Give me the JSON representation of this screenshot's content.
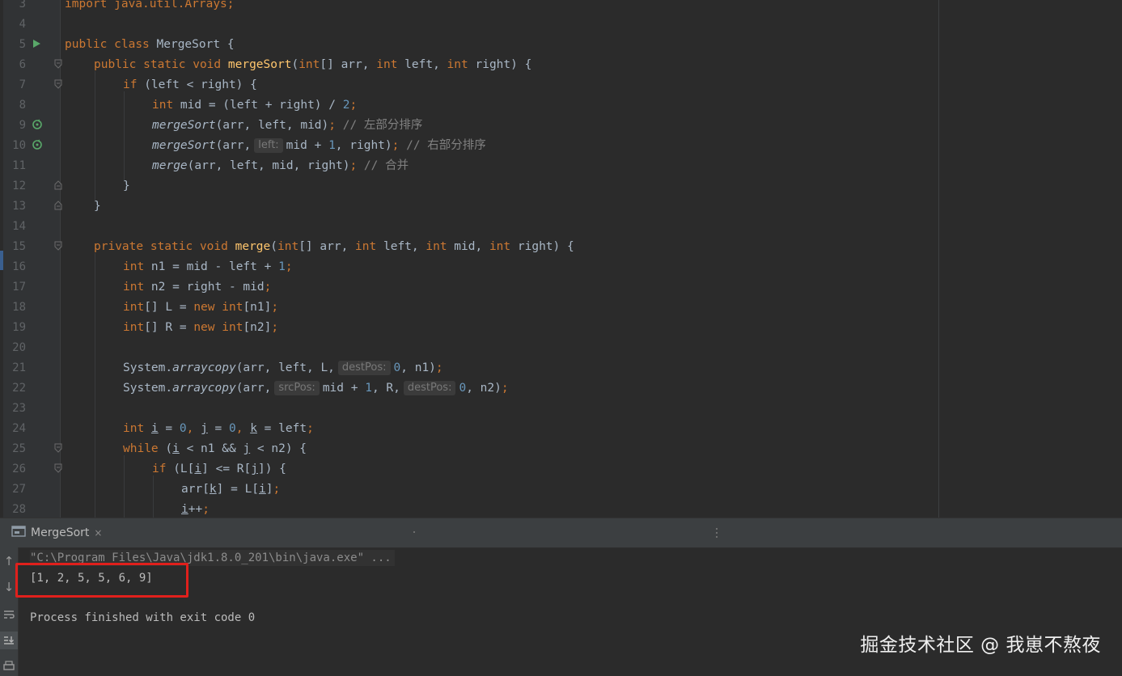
{
  "gutter": {
    "line_numbers": [
      "3",
      "4",
      "5",
      "6",
      "7",
      "8",
      "9",
      "10",
      "11",
      "12",
      "13",
      "14",
      "15",
      "16",
      "17",
      "18",
      "19",
      "20",
      "21",
      "22",
      "23",
      "24",
      "25",
      "26",
      "27",
      "28"
    ]
  },
  "code": {
    "line3": "import java.util.Arrays;",
    "line5_kw1": "public",
    "line5_kw2": "class",
    "line5_name": "MergeSort {",
    "line6_kw": "public static void",
    "line6_fn": "mergeSort",
    "line6_kw2": "int",
    "line6_a": "[] arr, ",
    "line6_kw3": "int",
    "line6_b": " left, ",
    "line6_kw4": "int",
    "line6_c": " right) {",
    "line7_kw": "if",
    "line7_rest": " (left < right) {",
    "line8_kw": "int",
    "line8_a": " mid = (left + right) / ",
    "line8_num": "2",
    "line8_end": ";",
    "line9_fn": "mergeSort",
    "line9_a": "(arr, left, mid)",
    "line9_semi": ";",
    "line9_cmt": "// 左部分排序",
    "line10_fn": "mergeSort",
    "line10_a": "(arr,",
    "line10_hint": "left:",
    "line10_b": "mid + ",
    "line10_num": "1",
    "line10_c": ", right)",
    "line10_semi": ";",
    "line10_cmt": "// 右部分排序",
    "line11_fn": "merge",
    "line11_a": "(arr, left, mid, right)",
    "line11_semi": ";",
    "line11_cmt": "// 合并",
    "line12": "}",
    "line13": "}",
    "line15_kw": "private static void",
    "line15_fn": "merge",
    "line15_kw2": "int",
    "line15_a": "[] arr, ",
    "line15_kw3": "int",
    "line15_b": " left, ",
    "line15_kw4": "int",
    "line15_c": " mid, ",
    "line15_kw5": "int",
    "line15_d": " right) {",
    "line16_kw": "int",
    "line16_a": " n1 = mid - left + ",
    "line16_num": "1",
    "line16_end": ";",
    "line17_kw": "int",
    "line17_a": " n2 = right - mid",
    "line17_end": ";",
    "line18_kw": "int",
    "line18_a": "[] L = ",
    "line18_kw2": "new",
    "line18_kw3": "int",
    "line18_b": "[n1]",
    "line18_end": ";",
    "line19_kw": "int",
    "line19_a": "[] R = ",
    "line19_kw2": "new",
    "line19_kw3": "int",
    "line19_b": "[n2]",
    "line19_end": ";",
    "line21_a": "System.",
    "line21_st": "arraycopy",
    "line21_b": "(arr, left, L,",
    "line21_hint": "destPos:",
    "line21_num": "0",
    "line21_c": ", n1)",
    "line21_end": ";",
    "line22_a": "System.",
    "line22_st": "arraycopy",
    "line22_b": "(arr,",
    "line22_hint1": "srcPos:",
    "line22_c": "mid + ",
    "line22_num1": "1",
    "line22_d": ", R,",
    "line22_hint2": "destPos:",
    "line22_num2": "0",
    "line22_e": ", n2)",
    "line22_end": ";",
    "line24_kw": "int",
    "line24_i": "i",
    "line24_a": " = ",
    "line24_num1": "0",
    "line24_b": ", ",
    "line24_j": "j",
    "line24_c": " = ",
    "line24_num2": "0",
    "line24_d": ", ",
    "line24_k": "k",
    "line24_e": " = left",
    "line24_end": ";",
    "line25_kw": "while",
    "line25_a": " (",
    "line25_i": "i",
    "line25_b": " < n1 && ",
    "line25_j": "j",
    "line25_c": " < n2) {",
    "line26_kw": "if",
    "line26_a": " (L[",
    "line26_i": "i",
    "line26_b": "] <= R[",
    "line26_j": "j",
    "line26_c": "]) {",
    "line27_a": "arr[",
    "line27_k": "k",
    "line27_b": "] = L[",
    "line27_i": "i",
    "line27_c": "]",
    "line27_end": ";",
    "line28_i": "i",
    "line28_a": "++",
    "line28_end": ";"
  },
  "run_panel": {
    "tab_label": "MergeSort",
    "close_glyph": "×",
    "command": "\"C:\\Program Files\\Java\\jdk1.8.0_201\\bin\\java.exe\" ...",
    "output": "[1, 2, 5, 5, 6, 9]",
    "exit_message": "Process finished with exit code 0"
  },
  "watermark": "掘金技术社区 @ 我崽不熬夜",
  "colors": {
    "background": "#2b2b2b",
    "keyword": "#cc7832",
    "function": "#ffc66d",
    "number": "#6897bb",
    "comment": "#808080",
    "highlight_box": "#e0201c"
  }
}
